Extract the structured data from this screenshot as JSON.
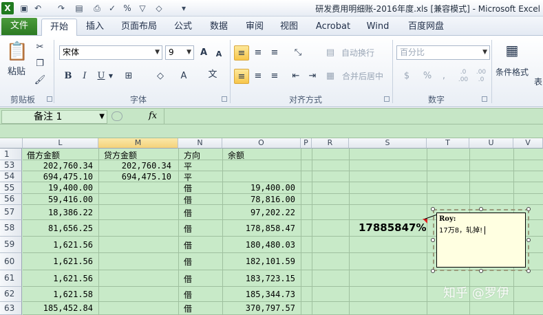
{
  "title_bar": {
    "title": "研发费用明细账-2016年度.xls  [兼容模式] - Microsoft Excel",
    "qa_icons": [
      "excel-logo-icon",
      "save-icon",
      "undo-icon",
      "redo-icon",
      "format-icon",
      "print-preview-icon",
      "spellcheck-icon",
      "percent-icon",
      "filter-icon",
      "fill-icon",
      "customize-icon"
    ],
    "qa_percent": "%"
  },
  "tabs": [
    "文件",
    "开始",
    "插入",
    "页面布局",
    "公式",
    "数据",
    "审阅",
    "视图",
    "Acrobat",
    "Wind",
    "百度网盘"
  ],
  "ribbon": {
    "clipboard": {
      "paste": "粘贴",
      "label": "剪贴板"
    },
    "font": {
      "name": "宋体",
      "size": "9",
      "bold": "B",
      "italic": "I",
      "underline": "U",
      "grow": "A",
      "shrink": "A",
      "color": "A",
      "label": "字体"
    },
    "alignment": {
      "wrap": "自动换行",
      "merge": "合并后居中",
      "label": "对齐方式"
    },
    "number": {
      "format": "百分比",
      "currency": "$",
      "percent": "%",
      "comma": ",",
      "dec_inc": ".0 .00",
      "dec_dec": ".00 .0",
      "label": "数字"
    },
    "styles": {
      "conditional": "条件格式",
      "table": "表"
    }
  },
  "formula_bar": {
    "name_box": "备注 1",
    "fx": "fx",
    "formula": ""
  },
  "columns": [
    {
      "letter": "L",
      "selected": false
    },
    {
      "letter": "M",
      "selected": true
    },
    {
      "letter": "N",
      "selected": false
    },
    {
      "letter": "O",
      "selected": false
    },
    {
      "letter": "P",
      "selected": false
    },
    {
      "letter": "R",
      "selected": false
    },
    {
      "letter": "S",
      "selected": false
    },
    {
      "letter": "T",
      "selected": false
    },
    {
      "letter": "U",
      "selected": false
    },
    {
      "letter": "V",
      "selected": false
    }
  ],
  "rows": [
    {
      "num": "1",
      "L": "借方金额",
      "M": "贷方金额",
      "N": "方向",
      "O": "余额"
    },
    {
      "num": "53",
      "L": "202,760.34",
      "M": "202,760.34",
      "N": "平",
      "O": ""
    },
    {
      "num": "54",
      "L": "694,475.10",
      "M": "694,475.10",
      "N": "平",
      "O": ""
    },
    {
      "num": "55",
      "L": "19,400.00",
      "M": "",
      "N": "借",
      "O": "19,400.00"
    },
    {
      "num": "56",
      "L": "59,416.00",
      "M": "",
      "N": "借",
      "O": "78,816.00"
    },
    {
      "num": "57",
      "L": "18,386.22",
      "M": "",
      "N": "借",
      "O": "97,202.22"
    },
    {
      "num": "58",
      "L": "81,656.25",
      "M": "",
      "N": "借",
      "O": "178,858.47",
      "S": "17885847%"
    },
    {
      "num": "59",
      "L": "1,621.56",
      "M": "",
      "N": "借",
      "O": "180,480.03"
    },
    {
      "num": "60",
      "L": "1,621.56",
      "M": "",
      "N": "借",
      "O": "182,101.59"
    },
    {
      "num": "61",
      "L": "1,621.56",
      "M": "",
      "N": "借",
      "O": "183,723.15"
    },
    {
      "num": "62",
      "L": "1,621.58",
      "M": "",
      "N": "借",
      "O": "185,344.73"
    },
    {
      "num": "63",
      "L": "185,452.84",
      "M": "",
      "N": "借",
      "O": "370,797.57"
    }
  ],
  "comment": {
    "author": "Roy:",
    "text": "17万8，轧掉!"
  },
  "watermark": "知乎 @罗伊"
}
